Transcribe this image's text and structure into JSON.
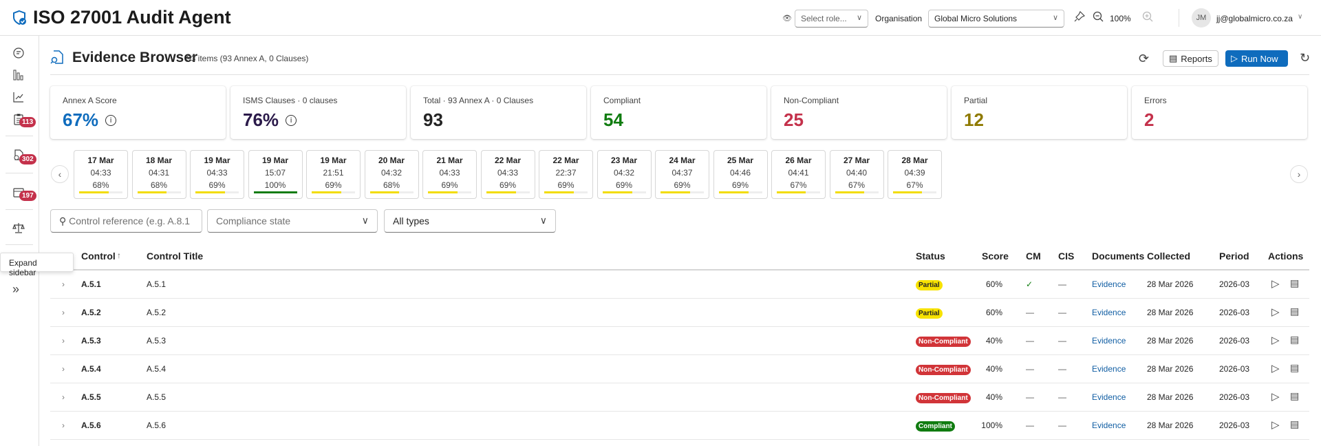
{
  "app": {
    "title": "ISO 27001 Audit Agent"
  },
  "header": {
    "role_placeholder": "Select role...",
    "org_label": "Organisation",
    "org_value": "Global Micro Solutions",
    "zoom": "100%",
    "avatar_initials": "JM",
    "user_email": "jj@globalmicro.co.za"
  },
  "sidebar": {
    "badges": [
      "113",
      "302",
      "197"
    ],
    "tooltip": "Expand sidebar"
  },
  "page": {
    "title": "Evidence Browser",
    "subtitle": "93 items (93 Annex A, 0 Clauses)",
    "reports_label": "Reports",
    "run_label": "Run Now"
  },
  "cards": [
    {
      "label": "Annex A Score",
      "value": "67%",
      "color": "#0f6cbd",
      "info": true
    },
    {
      "label": "ISMS Clauses · 0 clauses",
      "value": "76%",
      "color": "#2b1a4a",
      "info": true
    },
    {
      "label": "Total · 93 Annex A · 0 Clauses",
      "value": "93",
      "color": "#242424"
    },
    {
      "label": "Compliant",
      "value": "54",
      "color": "#107c10"
    },
    {
      "label": "Non-Compliant",
      "value": "25",
      "color": "#c4314b"
    },
    {
      "label": "Partial",
      "value": "12",
      "color": "#8f7a00"
    },
    {
      "label": "Errors",
      "value": "2",
      "color": "#c4314b"
    }
  ],
  "timeline": [
    {
      "date": "17 Mar",
      "time": "04:33",
      "pct": "68%"
    },
    {
      "date": "18 Mar",
      "time": "04:31",
      "pct": "68%"
    },
    {
      "date": "19 Mar",
      "time": "04:33",
      "pct": "69%"
    },
    {
      "date": "19 Mar",
      "time": "15:07",
      "pct": "100%"
    },
    {
      "date": "19 Mar",
      "time": "21:51",
      "pct": "69%"
    },
    {
      "date": "20 Mar",
      "time": "04:32",
      "pct": "68%"
    },
    {
      "date": "21 Mar",
      "time": "04:33",
      "pct": "69%"
    },
    {
      "date": "22 Mar",
      "time": "04:33",
      "pct": "69%"
    },
    {
      "date": "22 Mar",
      "time": "22:37",
      "pct": "69%"
    },
    {
      "date": "23 Mar",
      "time": "04:32",
      "pct": "69%"
    },
    {
      "date": "24 Mar",
      "time": "04:37",
      "pct": "69%"
    },
    {
      "date": "25 Mar",
      "time": "04:46",
      "pct": "69%"
    },
    {
      "date": "26 Mar",
      "time": "04:41",
      "pct": "67%"
    },
    {
      "date": "27 Mar",
      "time": "04:40",
      "pct": "67%"
    },
    {
      "date": "28 Mar",
      "time": "04:39",
      "pct": "67%"
    }
  ],
  "filters": {
    "search_placeholder": "Control reference (e.g. A.8.1",
    "compliance_placeholder": "Compliance state",
    "type_value": "All types"
  },
  "table": {
    "headers": {
      "control": "Control",
      "sort": "↑",
      "title": "Control Title",
      "status": "Status",
      "score": "Score",
      "cm": "CM",
      "cis": "CIS",
      "documents": "Documents",
      "collected": "Collected",
      "period": "Period",
      "actions": "Actions"
    },
    "rows": [
      {
        "control": "A.5.1",
        "title": "A.5.1",
        "status": "Partial",
        "score": "60%",
        "cm": "✓",
        "cis": "—",
        "documents": "Evidence",
        "collected": "28 Mar 2026",
        "period": "2026-03"
      },
      {
        "control": "A.5.2",
        "title": "A.5.2",
        "status": "Partial",
        "score": "60%",
        "cm": "—",
        "cis": "—",
        "documents": "Evidence",
        "collected": "28 Mar 2026",
        "period": "2026-03"
      },
      {
        "control": "A.5.3",
        "title": "A.5.3",
        "status": "Non-Compliant",
        "score": "40%",
        "cm": "—",
        "cis": "—",
        "documents": "Evidence",
        "collected": "28 Mar 2026",
        "period": "2026-03"
      },
      {
        "control": "A.5.4",
        "title": "A.5.4",
        "status": "Non-Compliant",
        "score": "40%",
        "cm": "—",
        "cis": "—",
        "documents": "Evidence",
        "collected": "28 Mar 2026",
        "period": "2026-03"
      },
      {
        "control": "A.5.5",
        "title": "A.5.5",
        "status": "Non-Compliant",
        "score": "40%",
        "cm": "—",
        "cis": "—",
        "documents": "Evidence",
        "collected": "28 Mar 2026",
        "period": "2026-03"
      },
      {
        "control": "A.5.6",
        "title": "A.5.6",
        "status": "Compliant",
        "score": "100%",
        "cm": "—",
        "cis": "—",
        "documents": "Evidence",
        "collected": "28 Mar 2026",
        "period": "2026-03"
      }
    ]
  },
  "colors": {
    "accent": "#0f6cbd",
    "partial": "#f7e200",
    "non_compliant": "#d13438",
    "compliant": "#107c10",
    "timeline_bar": "#f2dc00",
    "timeline_bar_full": "#107c10"
  }
}
